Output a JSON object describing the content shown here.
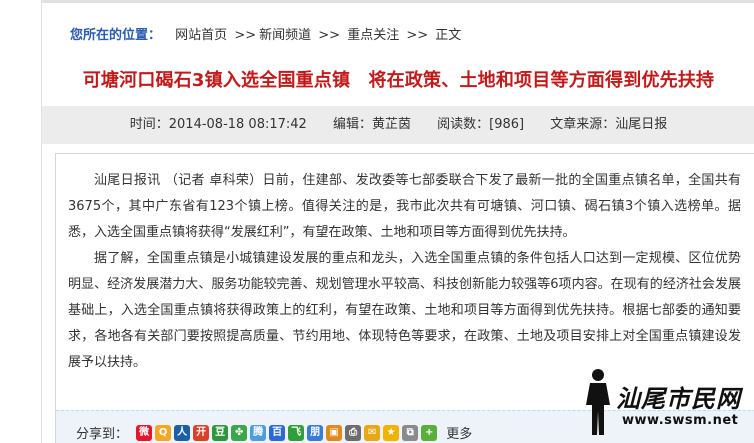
{
  "breadcrumb": {
    "lead": "您所在的位置：",
    "items": [
      "网站首页",
      "新闻频道",
      "重点关注",
      "正文"
    ],
    "separator": ">>"
  },
  "headline": "可塘河口碣石3镇入选全国重点镇　将在政策、土地和项目等方面得到优先扶持",
  "meta": {
    "time": "时间：2014-08-18 08:17:42",
    "editor": "编辑：黄芷茵",
    "views": "阅读数：[986]",
    "source": "文章来源：汕尾日报"
  },
  "article": {
    "paragraphs": [
      "汕尾日报讯 （记者 卓科荣）日前，住建部、发改委等七部委联合下发了最新一批的全国重点镇名单，全国共有3675个，其中广东省有123个镇上榜。值得关注的是，我市此次共有可塘镇、河口镇、碣石镇3个镇入选榜单。据悉，入选全国重点镇将获得“发展红利”，有望在政策、土地和项目等方面得到优先扶持。",
      "据了解，全国重点镇是小城镇建设发展的重点和龙头，入选全国重点镇的条件包括人口达到一定规模、区位优势明显、经济发展潜力大、服务功能较完善、规划管理水平较高、科技创新能力较强等6项内容。在现有的经济社会发展基础上，入选全国重点镇将获得政策上的红利，有望在政策、土地和项目等方面得到优先扶持。根据七部委的通知要求，各地各有关部门要按照提高质量、节约用地、体现特色等要求，在政策、土地及项目安排上对全国重点镇建设发展予以扶持。"
    ]
  },
  "share": {
    "label": "分享到：",
    "more_label": "更多",
    "icons": [
      {
        "name": "share-weibo-icon",
        "glyph": "微",
        "color": "#e6162d"
      },
      {
        "name": "share-qzone-icon",
        "glyph": "Q",
        "color": "#f5a623"
      },
      {
        "name": "share-renren-icon",
        "glyph": "人",
        "color": "#1c5fa8"
      },
      {
        "name": "share-kaixin-icon",
        "glyph": "开",
        "color": "#d8422b"
      },
      {
        "name": "share-douban-icon",
        "glyph": "豆",
        "color": "#2e963d"
      },
      {
        "name": "share-clover-icon",
        "glyph": "✤",
        "color": "#3aa84a"
      },
      {
        "name": "share-tencent-weibo-icon",
        "glyph": "腾",
        "color": "#4b9de0"
      },
      {
        "name": "share-baidu-icon",
        "glyph": "百",
        "color": "#2d68d8"
      },
      {
        "name": "share-feixin-icon",
        "glyph": "飞",
        "color": "#2f9e3b"
      },
      {
        "name": "share-pengyou-icon",
        "glyph": "朋",
        "color": "#3a7bd5"
      },
      {
        "name": "share-box-icon",
        "glyph": "▣",
        "color": "#e08a1e"
      },
      {
        "name": "share-print-icon",
        "glyph": "⎙",
        "color": "#6d6d6d"
      },
      {
        "name": "share-email-icon",
        "glyph": "✉",
        "color": "#e6a817"
      },
      {
        "name": "share-favorite-icon",
        "glyph": "★",
        "color": "#f0b400"
      },
      {
        "name": "share-copy-icon",
        "glyph": "⧉",
        "color": "#8a8a8a"
      },
      {
        "name": "share-more-icon",
        "glyph": "+",
        "color": "#5aae3a"
      }
    ]
  },
  "watermark": {
    "script": "汕尾市民网",
    "url": "www.swsm.net"
  },
  "colors": {
    "link_blue": "#2a5db0",
    "headline_red": "#c21a1a",
    "meta_bar_bg": "#ececec",
    "share_bar_bg": "#eef3fa"
  }
}
